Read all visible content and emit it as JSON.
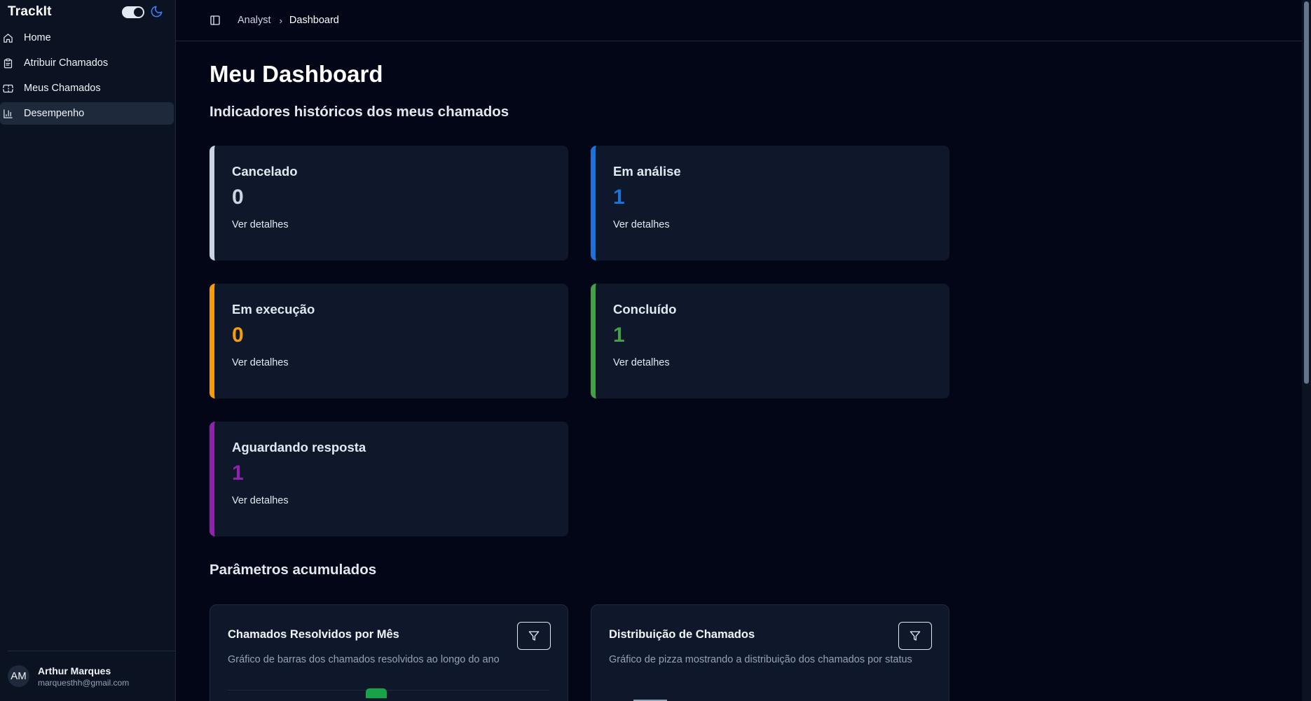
{
  "sidebar": {
    "brand": "TrackIt",
    "items": [
      {
        "label": "Home",
        "icon": "home-icon"
      },
      {
        "label": "Atribuir Chamados",
        "icon": "clipboard-icon"
      },
      {
        "label": "Meus Chamados",
        "icon": "ticket-icon"
      },
      {
        "label": "Desempenho",
        "icon": "chart-icon",
        "active": true
      }
    ],
    "user": {
      "initials": "AM",
      "name": "Arthur Marques",
      "email": "marquesthh@gmail.com"
    }
  },
  "breadcrumb": {
    "parent": "Analyst",
    "current": "Dashboard"
  },
  "page": {
    "title": "Meu Dashboard",
    "subtitle": "Indicadores históricos dos meus chamados",
    "section2": "Parâmetros acumulados"
  },
  "cards": [
    {
      "title": "Cancelado",
      "value": "0",
      "link": "Ver detalhes",
      "color": "#cbd5e1"
    },
    {
      "title": "Em análise",
      "value": "1",
      "link": "Ver detalhes",
      "color": "#1d72d8"
    },
    {
      "title": "Em execução",
      "value": "0",
      "link": "Ver detalhes",
      "color": "#f59e0b"
    },
    {
      "title": "Concluído",
      "value": "1",
      "link": "Ver detalhes",
      "color": "#43a047"
    },
    {
      "title": "Aguardando resposta",
      "value": "1",
      "link": "Ver detalhes",
      "color": "#8e24aa"
    }
  ],
  "charts": [
    {
      "title": "Chamados Resolvidos por Mês",
      "description": "Gráfico de barras dos chamados resolvidos ao longo do ano"
    },
    {
      "title": "Distribuição de Chamados",
      "description": "Gráfico de pizza mostrando a distribuição dos chamados por status"
    }
  ],
  "colors": {
    "background": "#020617",
    "sidebar": "#0b1221",
    "card": "#0f172a",
    "accent_blue": "#3b82f6"
  }
}
